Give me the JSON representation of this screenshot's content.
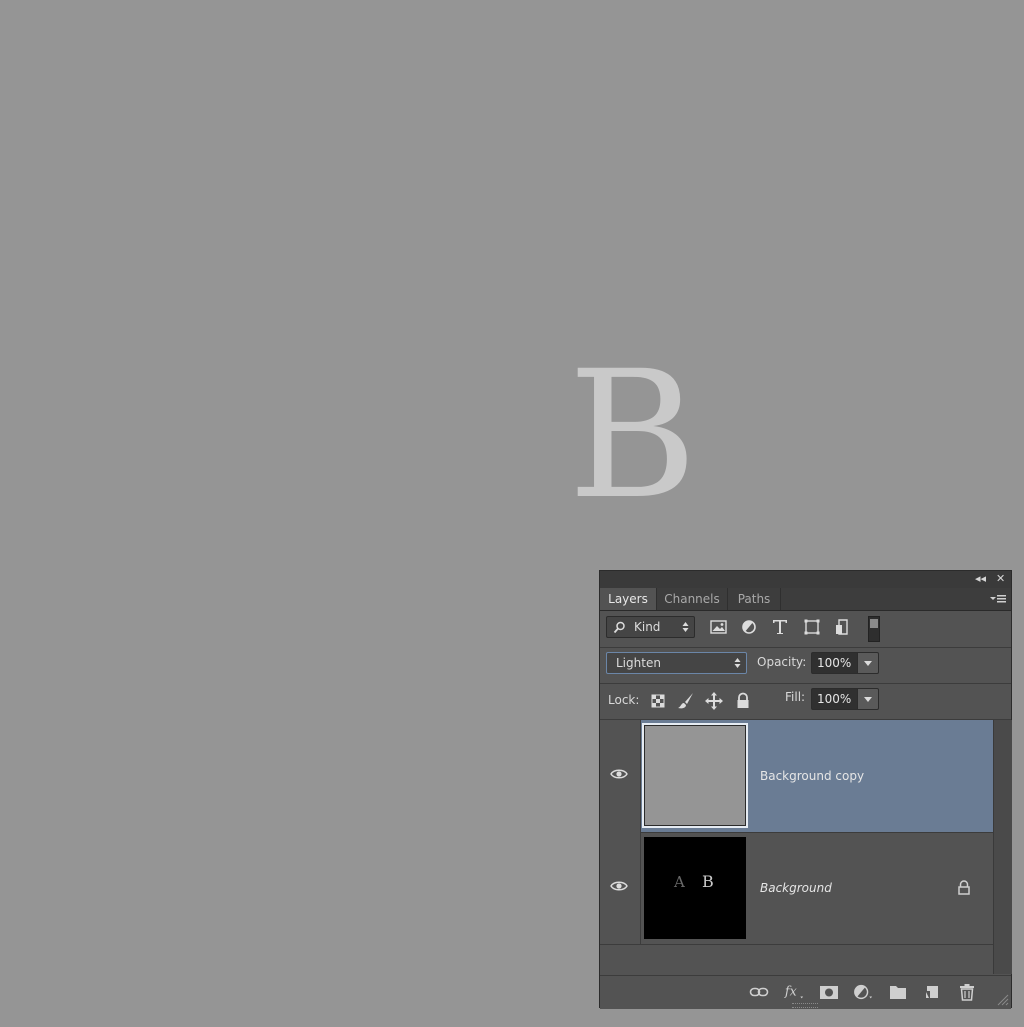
{
  "canvas": {
    "letter": "B"
  },
  "panel": {
    "titlebar": {
      "collapse_icon": "◂◂",
      "close_icon": "✕"
    },
    "tabs": [
      {
        "label": "Layers",
        "active": true
      },
      {
        "label": "Channels",
        "active": false
      },
      {
        "label": "Paths",
        "active": false
      }
    ],
    "filter": {
      "kind_label": "Kind"
    },
    "blend": {
      "mode": "Lighten",
      "opacity_label": "Opacity:",
      "opacity_value": "100%"
    },
    "lock": {
      "label": "Lock:",
      "fill_label": "Fill:",
      "fill_value": "100%"
    },
    "layers": [
      {
        "name": "Background copy",
        "selected": true
      },
      {
        "name": "Background",
        "selected": false,
        "locked": true,
        "thumb_text_a": "A",
        "thumb_text_b": "B"
      }
    ]
  },
  "colors": {
    "selected_row": "#6a7c94",
    "panel_bg": "#535353",
    "canvas_bg": "#959595"
  }
}
